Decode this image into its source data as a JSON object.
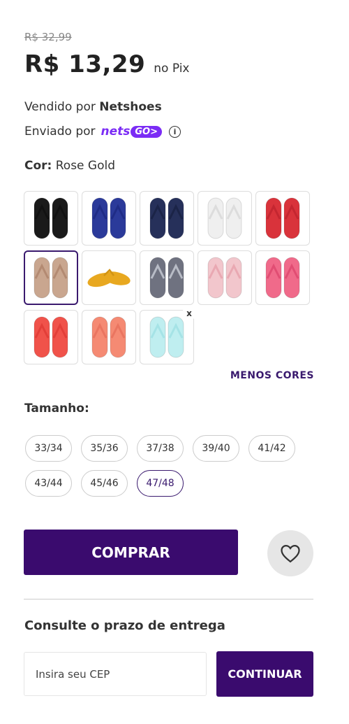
{
  "price": {
    "old": "R$ 32,99",
    "current": "R$ 13,29",
    "method": "no Pix"
  },
  "seller": {
    "prefix": "Vendido por",
    "name": "Netshoes"
  },
  "shipping": {
    "prefix": "Enviado por",
    "logo_text_1": "nets",
    "logo_text_2": "GO>"
  },
  "color": {
    "label": "Cor:",
    "selected": "Rose Gold",
    "options": [
      {
        "name": "preto",
        "color": "#1a1a1a",
        "strap": "#111111"
      },
      {
        "name": "azul",
        "color": "#2b3a9a",
        "strap": "#1f2c86"
      },
      {
        "name": "marinho",
        "color": "#26305a",
        "strap": "#1b2447"
      },
      {
        "name": "branco",
        "color": "#efefef",
        "strap": "#dcdcdc"
      },
      {
        "name": "vermelho",
        "color": "#d9333b",
        "strap": "#c42630"
      },
      {
        "name": "rose-gold",
        "color": "#c9a68f",
        "strap": "#b38a72"
      },
      {
        "name": "amarelo",
        "color": "#e8a820",
        "strap": "#d19415"
      },
      {
        "name": "cinza",
        "color": "#6f7280",
        "strap": "#b8bcc6"
      },
      {
        "name": "rosa-claro",
        "color": "#f2c6cc",
        "strap": "#e9a8b2"
      },
      {
        "name": "pink",
        "color": "#f06a8a",
        "strap": "#e14d73"
      },
      {
        "name": "coral",
        "color": "#f0524a",
        "strap": "#e33e38"
      },
      {
        "name": "salmao",
        "color": "#f58a73",
        "strap": "#ea7560"
      },
      {
        "name": "azul-claro",
        "color": "#bfeef0",
        "strap": "#a5e3e6"
      }
    ],
    "less_label": "MENOS CORES",
    "remove_label": "x"
  },
  "size": {
    "label": "Tamanho:",
    "options": [
      "33/34",
      "35/36",
      "37/38",
      "39/40",
      "41/42",
      "43/44",
      "45/46",
      "47/48"
    ],
    "selected": "47/48"
  },
  "actions": {
    "buy_label": "COMPRAR"
  },
  "delivery": {
    "title": "Consulte o prazo de entrega",
    "placeholder": "Insira seu CEP",
    "continue_label": "CONTINUAR"
  }
}
